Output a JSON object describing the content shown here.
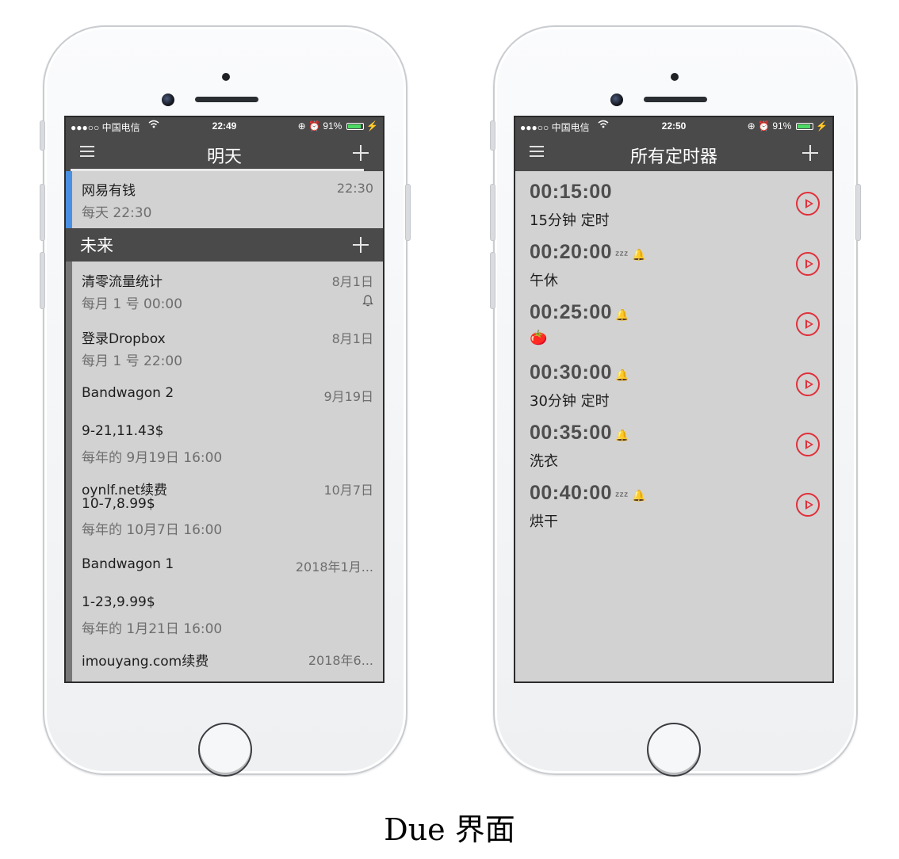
{
  "left_phone": {
    "status": {
      "carrier": "●●●○○ 中国电信 ",
      "time": "22:49",
      "battery": "91%",
      "right_icons": "⊕ ⏰ "
    },
    "nav": {
      "title": "明天"
    },
    "today_item": {
      "title": "网易有钱",
      "subtitle": "每天 22:30",
      "date": "22:30"
    },
    "section": {
      "label": "未来"
    },
    "items": [
      {
        "title": "清零流量统计",
        "subtitle": "每月 1 号 00:00",
        "date": "8月1日",
        "bell": "🔔"
      },
      {
        "title": "登录Dropbox",
        "subtitle": "每月 1 号 22:00",
        "date": "8月1日"
      },
      {
        "title": "Bandwagon 2",
        "date": "9月19日"
      },
      {
        "title": "9-21,11.43$",
        "subtitle": "每年的 9月19日 16:00"
      },
      {
        "title": "oynlf.net续费",
        "title2": "10-7,8.99$",
        "subtitle": "每年的 10月7日 16:00",
        "date": "10月7日"
      },
      {
        "title": "Bandwagon 1",
        "date": "2018年1月..."
      },
      {
        "title": "1-23,9.99$",
        "subtitle": "每年的 1月21日 16:00"
      },
      {
        "title": "imouyang.com续费",
        "date": "2018年6..."
      }
    ]
  },
  "right_phone": {
    "status": {
      "carrier": "●●●○○ 中国电信 ",
      "time": "22:50",
      "battery": "91%",
      "right_icons": "⊕ ⏰ "
    },
    "nav": {
      "title": "所有定时器"
    },
    "timers": [
      {
        "time": "00:15:00",
        "marks": "",
        "label": "15分钟 定时"
      },
      {
        "time": "00:20:00",
        "marks": "ᶻᶻᶻ 🔔",
        "label": "午休"
      },
      {
        "time": "00:25:00",
        "marks": "🔔",
        "label": "🍅"
      },
      {
        "time": "00:30:00",
        "marks": "🔔",
        "label": "30分钟 定时"
      },
      {
        "time": "00:35:00",
        "marks": "🔔",
        "label": "洗衣"
      },
      {
        "time": "00:40:00",
        "marks": "ᶻᶻᶻ 🔔",
        "label": "烘干"
      }
    ]
  },
  "caption": "Due 界面",
  "colors": {
    "header": "#4a4a4a",
    "list_bg": "#d2d2d2",
    "accent_blue": "#4a90e2",
    "play_red": "#e0303a"
  }
}
